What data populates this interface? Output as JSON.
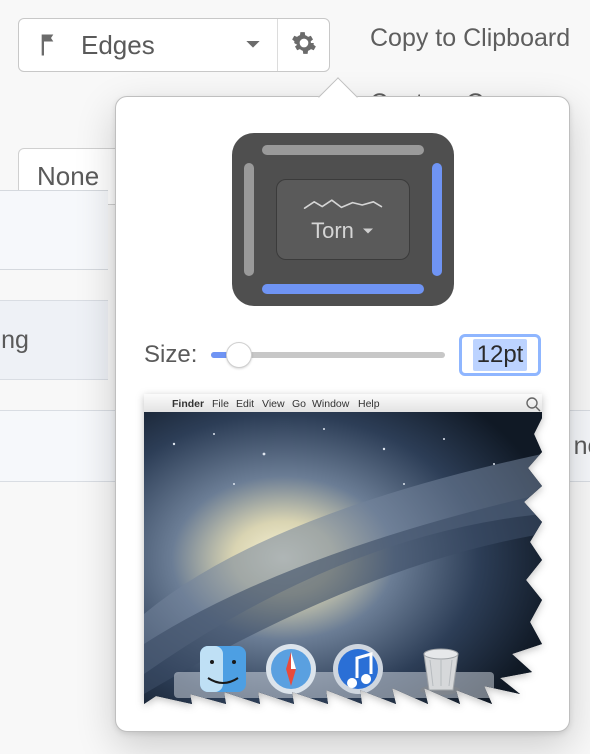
{
  "toolbar": {
    "edges_label": "Edges",
    "edges_icon": "edges-bookmark-icon",
    "gear_icon": "gear-icon"
  },
  "actions": {
    "copy_label": "Copy to Clipboard",
    "cursor_label": "Capture Cursor"
  },
  "row2": {
    "none_label": "None"
  },
  "strips": {
    "ling_fragment": "ling",
    "nc_fragment": "nc"
  },
  "popover": {
    "torn_label": "Torn",
    "size_label": "Size:",
    "size_value": "12pt",
    "preview": {
      "menubar_items": [
        "Finder",
        "File",
        "Edit",
        "View",
        "Go",
        "Window",
        "Help"
      ]
    },
    "edge_state": {
      "top": "off",
      "left": "off",
      "right": "on",
      "bottom": "on"
    }
  }
}
